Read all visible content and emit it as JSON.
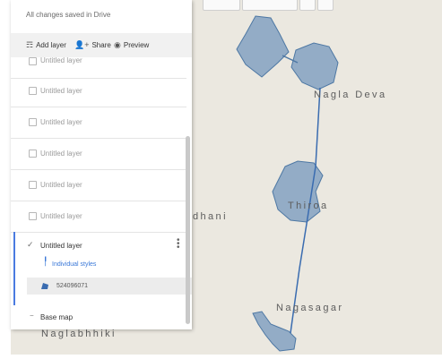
{
  "header": {
    "saved_status": "All changes saved in Drive"
  },
  "toolbar": {
    "add_layer_label": "Add layer",
    "share_label": "Share",
    "preview_label": "Preview"
  },
  "layers": {
    "items": [
      {
        "label": "Untitled layer"
      },
      {
        "label": "Untitled layer"
      },
      {
        "label": "Untitled layer"
      },
      {
        "label": "Untitled layer"
      },
      {
        "label": "Untitled layer"
      },
      {
        "label": "Untitled layer"
      }
    ],
    "selected": {
      "label": "Untitled layer",
      "style_label": "Individual styles",
      "feature_name": "524096071",
      "checked": true
    }
  },
  "base_map": {
    "label": "Base map"
  },
  "map": {
    "places": [
      "Nagla Deva",
      "Thiroa",
      "Nagasagar",
      "dhani",
      "Naglabhhiki"
    ],
    "polygon_color": "#93acc6",
    "polygon_stroke": "#4e78a4",
    "route_color": "#3a6cb0"
  }
}
